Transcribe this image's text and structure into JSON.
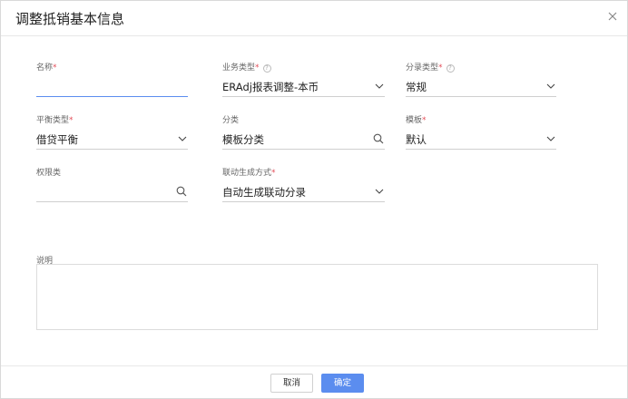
{
  "dialog": {
    "title": "调整抵销基本信息",
    "close_icon": "close-icon"
  },
  "fields": {
    "name": {
      "label": "名称",
      "required_mark": "*",
      "value": ""
    },
    "business_type": {
      "label": "业务类型",
      "required_mark": "*",
      "help": "?",
      "value": "ERAdj报表调整-本币"
    },
    "entry_type": {
      "label": "分录类型",
      "required_mark": "*",
      "help": "?",
      "value": "常规"
    },
    "balance_type": {
      "label": "平衡类型",
      "required_mark": "*",
      "value": "借贷平衡"
    },
    "category": {
      "label": "分类",
      "value": "模板分类"
    },
    "template": {
      "label": "模板",
      "required_mark": "*",
      "value": "默认"
    },
    "permission_class": {
      "label": "权限类",
      "value": ""
    },
    "linkage_method": {
      "label": "联动生成方式",
      "required_mark": "*",
      "value": "自动生成联动分录"
    }
  },
  "description": {
    "label": "说明",
    "value": ""
  },
  "footer": {
    "cancel_label": "取消",
    "ok_label": "确定"
  },
  "colors": {
    "primary": "#5b8def",
    "required": "#e34d59"
  }
}
